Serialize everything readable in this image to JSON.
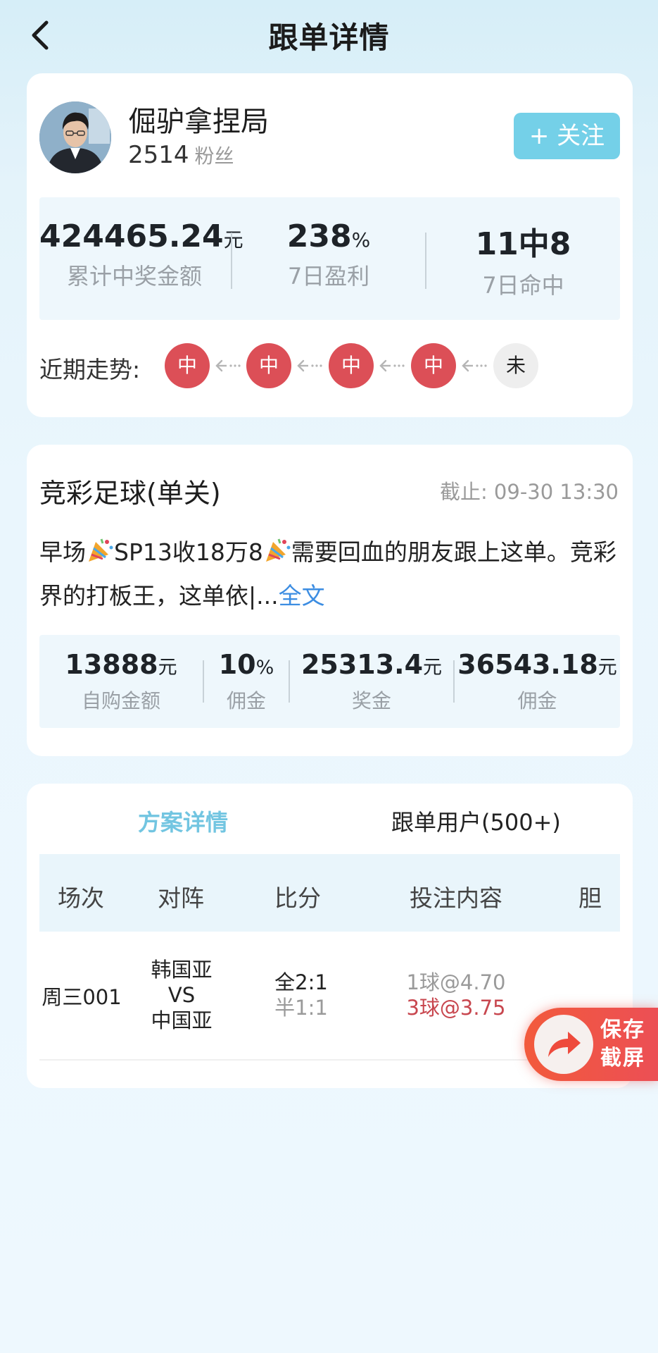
{
  "header": {
    "title": "跟单详情"
  },
  "profile": {
    "name": "倔驴拿捏局",
    "fans_count": "2514",
    "fans_label": "粉丝",
    "follow_label": "+ 关注"
  },
  "stats": [
    {
      "value": "424465.24",
      "unit": "元",
      "label": "累计中奖金额"
    },
    {
      "value": "238",
      "unit": "%",
      "label": "7日盈利"
    },
    {
      "value": "11中8",
      "unit": "",
      "label": "7日命中"
    }
  ],
  "trend": {
    "label": "近期走势:",
    "items": [
      {
        "text": "中",
        "status": "win"
      },
      {
        "text": "中",
        "status": "win"
      },
      {
        "text": "中",
        "status": "win"
      },
      {
        "text": "中",
        "status": "win"
      },
      {
        "text": "未",
        "status": "pending"
      }
    ]
  },
  "lottery": {
    "title": "竞彩足球(单关)",
    "deadline": "截止: 09-30 13:30",
    "desc_1": "早场",
    "desc_2": "SP13收18万8",
    "desc_3": "需要回血的朋友跟上这单。竞彩界的打板王，这单依|...",
    "more_label": "全文"
  },
  "order_stats": [
    {
      "value": "13888",
      "unit": "元",
      "label": "自购金额"
    },
    {
      "value": "10",
      "unit": "%",
      "label": "佣金"
    },
    {
      "value": "25313.4",
      "unit": "元",
      "label": "奖金"
    },
    {
      "value": "36543.18",
      "unit": "元",
      "label": "佣金"
    }
  ],
  "tabs": [
    {
      "label": "方案详情",
      "active": true
    },
    {
      "label": "跟单用户(500+)",
      "active": false
    }
  ],
  "table": {
    "headers": [
      "场次",
      "对阵",
      "比分",
      "投注内容",
      "胆"
    ],
    "rows": [
      {
        "match_no": "周三001",
        "home": "韩国亚",
        "vs": "VS",
        "away": "中国亚",
        "score_full": "全2:1",
        "score_half": "半1:1",
        "bet_1": "1球@4.70",
        "bet_2": "3球@3.75",
        "banker": ""
      }
    ]
  },
  "float_button": {
    "line1": "保存",
    "line2": "截屏"
  },
  "colors": {
    "accent": "#74d0e8",
    "win": "#dc4f57",
    "link": "#3c8de2",
    "bet_highlight": "#c8474f"
  }
}
